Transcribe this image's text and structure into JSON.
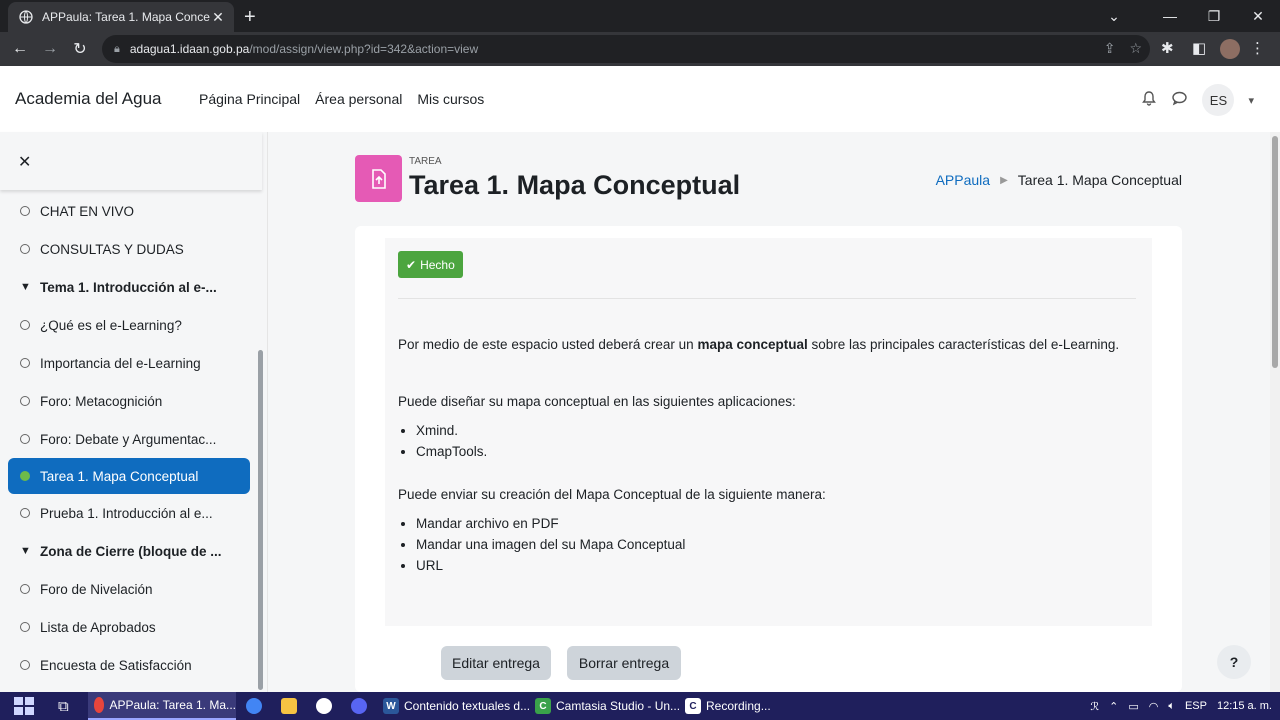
{
  "browser": {
    "tab_title": "APPaula: Tarea 1. Mapa Concept",
    "url_host": "adagua1.idaan.gob.pa",
    "url_path": "/mod/assign/view.php?id=342&action=view"
  },
  "navbar": {
    "brand": "Academia del Agua",
    "links": [
      "Página Principal",
      "Área personal",
      "Mis cursos"
    ],
    "user_initials": "ES"
  },
  "drawer": {
    "items": [
      {
        "type": "item",
        "label": "CHAT EN VIVO"
      },
      {
        "type": "item",
        "label": "CONSULTAS Y DUDAS"
      },
      {
        "type": "section",
        "label": "Tema 1. Introducción al e-..."
      },
      {
        "type": "item",
        "label": "¿Qué es el e-Learning?"
      },
      {
        "type": "item",
        "label": "Importancia del e-Learning"
      },
      {
        "type": "item",
        "label": "Foro: Metacognición"
      },
      {
        "type": "item",
        "label": "Foro: Debate y Argumentac..."
      },
      {
        "type": "active",
        "label": "Tarea 1. Mapa Conceptual"
      },
      {
        "type": "item",
        "label": "Prueba 1. Introducción al e..."
      },
      {
        "type": "section",
        "label": "Zona de Cierre (bloque de ..."
      },
      {
        "type": "item",
        "label": "Foro de Nivelación"
      },
      {
        "type": "item",
        "label": "Lista de Aprobados"
      },
      {
        "type": "item",
        "label": "Encuesta de Satisfacción"
      }
    ]
  },
  "page": {
    "kicker": "TAREA",
    "title": "Tarea 1. Mapa Conceptual",
    "breadcrumb": [
      "APPaula",
      "Tarea 1. Mapa Conceptual"
    ]
  },
  "assignment": {
    "status_badge": "Hecho",
    "desc_before": "Por medio de este espacio usted deberá crear un ",
    "desc_bold": "mapa conceptual",
    "desc_after": " sobre las principales características del e-Learning.",
    "apps_intro": "Puede diseñar su mapa conceptual en las siguientes aplicaciones:",
    "apps": [
      "Xmind.",
      "CmapTools."
    ],
    "send_intro": "Puede enviar su creación del Mapa Conceptual de la siguiente manera:",
    "send_options": [
      "Mandar archivo en PDF",
      "Mandar una imagen del su Mapa Conceptual",
      "URL"
    ],
    "edit_button": "Editar entrega",
    "delete_button": "Borrar entrega"
  },
  "help_label": "?",
  "taskbar": {
    "items": [
      "APPaula: Tarea 1. Ma...",
      "Contenido textuales d...",
      "Camtasia Studio - Un...",
      "Recording..."
    ],
    "language": "ESP",
    "time": "12:15 a. m."
  }
}
